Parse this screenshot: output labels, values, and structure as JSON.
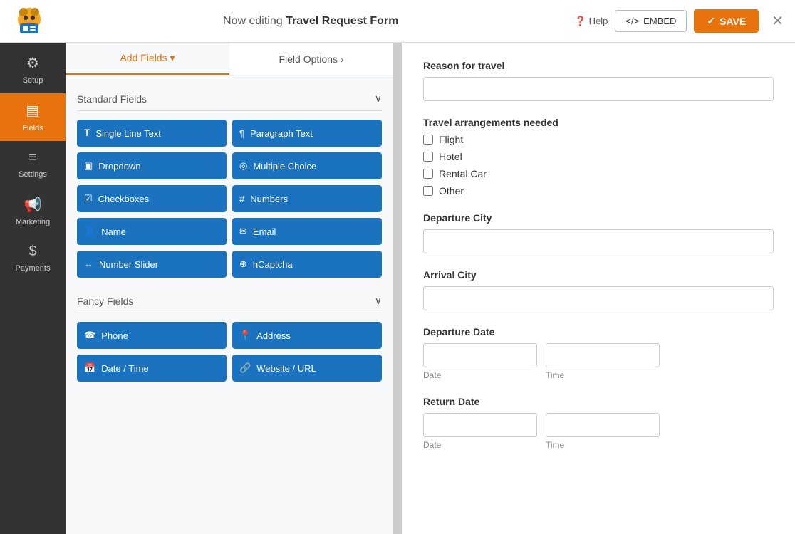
{
  "topbar": {
    "editing_prefix": "Now editing ",
    "form_name": "Travel Request Form",
    "help_label": "Help",
    "embed_label": "EMBED",
    "save_label": "SAVE"
  },
  "sidebar": {
    "items": [
      {
        "id": "setup",
        "label": "Setup",
        "icon": "⚙",
        "active": false
      },
      {
        "id": "fields",
        "label": "Fields",
        "icon": "▤",
        "active": true
      },
      {
        "id": "settings",
        "label": "Settings",
        "icon": "≡",
        "active": false
      },
      {
        "id": "marketing",
        "label": "Marketing",
        "icon": "📢",
        "active": false
      },
      {
        "id": "payments",
        "label": "Payments",
        "icon": "$",
        "active": false
      }
    ]
  },
  "fields_panel": {
    "header": "Fields",
    "tab_add": "Add Fields",
    "tab_options": "Field Options",
    "standard_section": "Standard Fields",
    "fancy_section": "Fancy Fields",
    "standard_fields": [
      {
        "id": "single-line",
        "label": "Single Line Text",
        "icon": "T"
      },
      {
        "id": "paragraph",
        "label": "Paragraph Text",
        "icon": "¶"
      },
      {
        "id": "dropdown",
        "label": "Dropdown",
        "icon": "▣"
      },
      {
        "id": "multiple-choice",
        "label": "Multiple Choice",
        "icon": "◎"
      },
      {
        "id": "checkboxes",
        "label": "Checkboxes",
        "icon": "☑"
      },
      {
        "id": "numbers",
        "label": "Numbers",
        "icon": "#"
      },
      {
        "id": "name",
        "label": "Name",
        "icon": "👤"
      },
      {
        "id": "email",
        "label": "Email",
        "icon": "✉"
      },
      {
        "id": "number-slider",
        "label": "Number Slider",
        "icon": "⇔"
      },
      {
        "id": "hcaptcha",
        "label": "hCaptcha",
        "icon": "⊕"
      }
    ],
    "fancy_fields": [
      {
        "id": "phone",
        "label": "Phone",
        "icon": "☎"
      },
      {
        "id": "address",
        "label": "Address",
        "icon": "📍"
      },
      {
        "id": "datetime",
        "label": "Date / Time",
        "icon": "📅"
      },
      {
        "id": "website",
        "label": "Website / URL",
        "icon": "🔗"
      }
    ]
  },
  "form_preview": {
    "fields": [
      {
        "id": "reason",
        "type": "text",
        "label": "Reason for travel"
      },
      {
        "id": "arrangements",
        "type": "checkboxes",
        "label": "Travel arrangements needed",
        "options": [
          "Flight",
          "Hotel",
          "Rental Car",
          "Other"
        ]
      },
      {
        "id": "departure-city",
        "type": "text",
        "label": "Departure City"
      },
      {
        "id": "arrival-city",
        "type": "text",
        "label": "Arrival City"
      },
      {
        "id": "departure-date",
        "type": "datetime",
        "label": "Departure Date",
        "date_label": "Date",
        "time_label": "Time"
      },
      {
        "id": "return-date",
        "type": "datetime",
        "label": "Return Date",
        "date_label": "Date",
        "time_label": "Time"
      }
    ]
  }
}
